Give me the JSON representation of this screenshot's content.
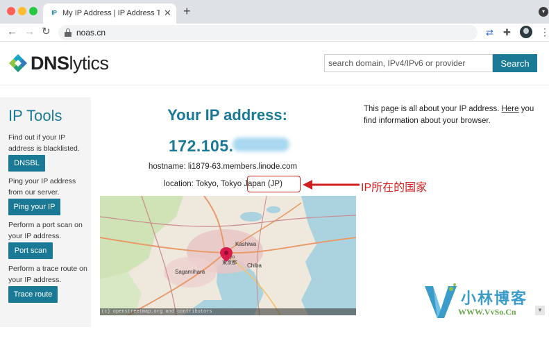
{
  "browser": {
    "tab_title": "My IP Address | IP Address Tools",
    "tab_favicon": "IP",
    "url": "noas.cn"
  },
  "header": {
    "logo_dns": "DNS",
    "logo_rest": "lytics",
    "search_placeholder": "search domain, IPv4/IPv6 or provider",
    "search_button": "Search"
  },
  "sidebar": {
    "title": "IP Tools",
    "items": [
      {
        "text": "Find out if your IP address is blacklisted.",
        "button": "DNSBL"
      },
      {
        "text": "Ping your IP address from our server.",
        "button": "Ping your IP"
      },
      {
        "text": "Perform a port scan on your IP address.",
        "button": "Port scan"
      },
      {
        "text": "Perform a trace route on your IP address.",
        "button": "Trace route"
      }
    ]
  },
  "main": {
    "heading": "Your IP address:",
    "ip": "172.105.",
    "hostname": "hostname: li1879-63.members.linode.com",
    "location_prefix": "location: Tokyo, Tokyo",
    "country": "Japan (JP)",
    "annotation": "IP所在的国家",
    "info_pre": "This page is all about your IP address. ",
    "info_link": "Here",
    "info_post": " you find information about your browser.",
    "map_attribution": "(c) openstreetmap.org and contributors"
  },
  "map_labels": [
    "Kashiwa",
    "Chiba",
    "Sagamihara",
    "Tokyo",
    "東京都"
  ],
  "watermark": {
    "text": "小林博客",
    "url": "WWW.VvSo.Cn"
  },
  "colors": {
    "accent": "#1a7a96",
    "annotation_red": "#d11f1f"
  }
}
